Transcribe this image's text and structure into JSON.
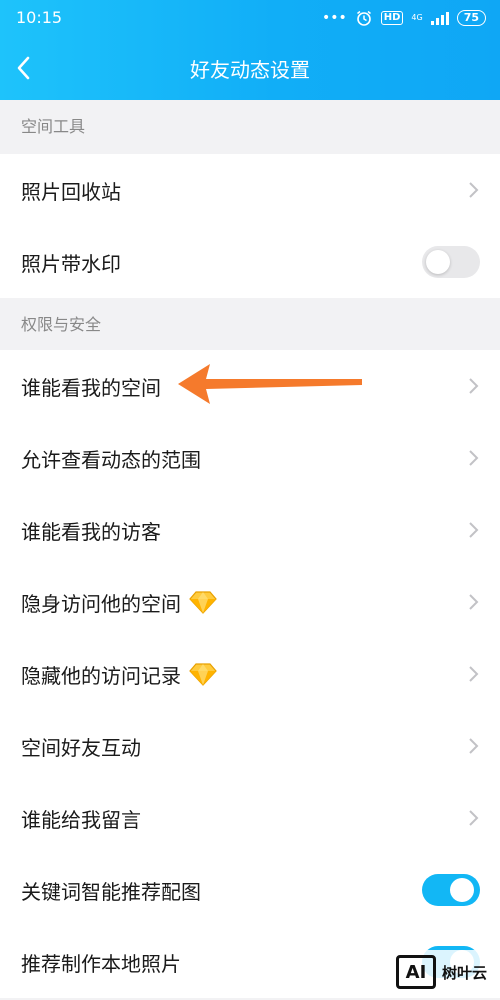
{
  "status_bar": {
    "time": "10:15",
    "dots": "•••",
    "hd": "HD",
    "network": "4G",
    "battery": "75"
  },
  "nav": {
    "title": "好友动态设置"
  },
  "sections": [
    {
      "label": "空间工具"
    },
    {
      "label": "权限与安全"
    }
  ],
  "rows": [
    {
      "label": "照片回收站",
      "control": "chevron"
    },
    {
      "label": "照片带水印",
      "control": "toggle",
      "on": false
    },
    {
      "label": "谁能看我的空间",
      "control": "chevron"
    },
    {
      "label": "允许查看动态的范围",
      "control": "chevron"
    },
    {
      "label": "谁能看我的访客",
      "control": "chevron"
    },
    {
      "label": "隐身访问他的空间",
      "control": "chevron",
      "badge": "diamond-icon"
    },
    {
      "label": "隐藏他的访问记录",
      "control": "chevron",
      "badge": "diamond-icon"
    },
    {
      "label": "空间好友互动",
      "control": "chevron"
    },
    {
      "label": "谁能给我留言",
      "control": "chevron"
    },
    {
      "label": "关键词智能推荐配图",
      "control": "toggle",
      "on": true
    },
    {
      "label": "推荐制作本地照片",
      "control": "toggle",
      "on": true
    }
  ],
  "annotation": {
    "color": "#f57a2c"
  },
  "watermark": {
    "logo_text": "AI",
    "text": "树叶云"
  },
  "colors": {
    "header": "#12b7f5",
    "toggle_on": "#12b7f5",
    "toggle_off": "#e8e8ea",
    "section_bg": "#f2f2f4"
  }
}
